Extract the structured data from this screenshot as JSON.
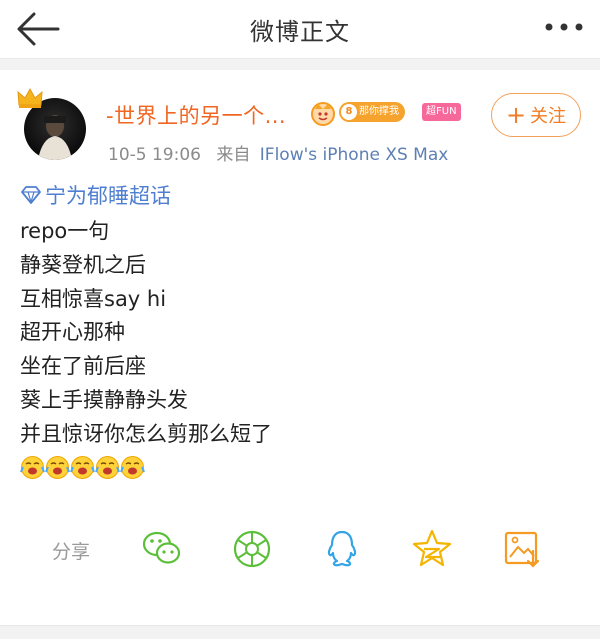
{
  "header": {
    "title": "微博正文",
    "back_icon": "arrow-left-icon",
    "more_icon": "more-dots-icon"
  },
  "post": {
    "username": "-世界上的另一个...",
    "badges": {
      "fan_level": "8",
      "fan_label": "那你撑我",
      "chao_label": "超FUN"
    },
    "follow_label": "关注",
    "timestamp": "10-5 19:06",
    "source_prefix": "来自",
    "source": "IFlow's iPhone XS Max",
    "topic": "宁为郁睡超话",
    "lines": [
      "repo一句",
      "静葵登机之后",
      "互相惊喜say hi",
      "超开心那种",
      "坐在了前后座",
      "葵上手摸静静头发",
      "并且惊讶你怎么剪那么短了"
    ],
    "emoji_count": 5
  },
  "share": {
    "label": "分享",
    "targets": [
      "wechat-icon",
      "moments-icon",
      "qq-icon",
      "qzone-icon",
      "save-image-icon"
    ]
  },
  "colors": {
    "accent_orange": "#f06623",
    "link_blue": "#4f7fd0",
    "source_blue": "#5d7fb4",
    "wechat_green": "#5bbf3a",
    "qq_blue": "#33a4e6",
    "qzone_yellow": "#f5b400",
    "save_orange": "#f59a23"
  }
}
